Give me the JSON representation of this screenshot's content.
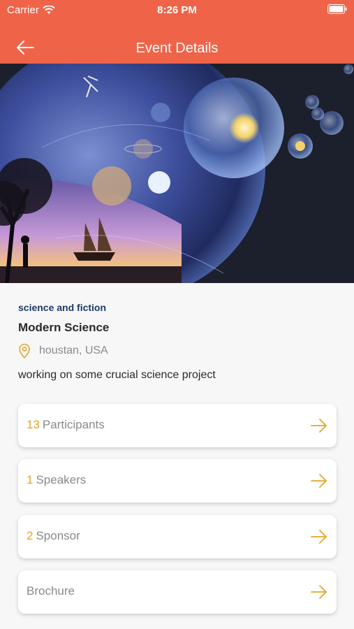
{
  "status_bar": {
    "carrier": "Carrier",
    "time": "8:26 PM"
  },
  "nav": {
    "title": "Event Details",
    "back_icon": "arrow-left-icon"
  },
  "event": {
    "category": "science and fiction",
    "title": "Modern Science",
    "location": "houstan, USA",
    "description": "working on some crucial science project"
  },
  "cards": [
    {
      "count": "13",
      "label": "Participants"
    },
    {
      "count": "1",
      "label": "Speakers"
    },
    {
      "count": "2",
      "label": "Sponsor"
    },
    {
      "count": "",
      "label": "Brochure"
    }
  ],
  "colors": {
    "header": "#ef6449",
    "accent": "#e4a52a",
    "category": "#1d3a67"
  }
}
